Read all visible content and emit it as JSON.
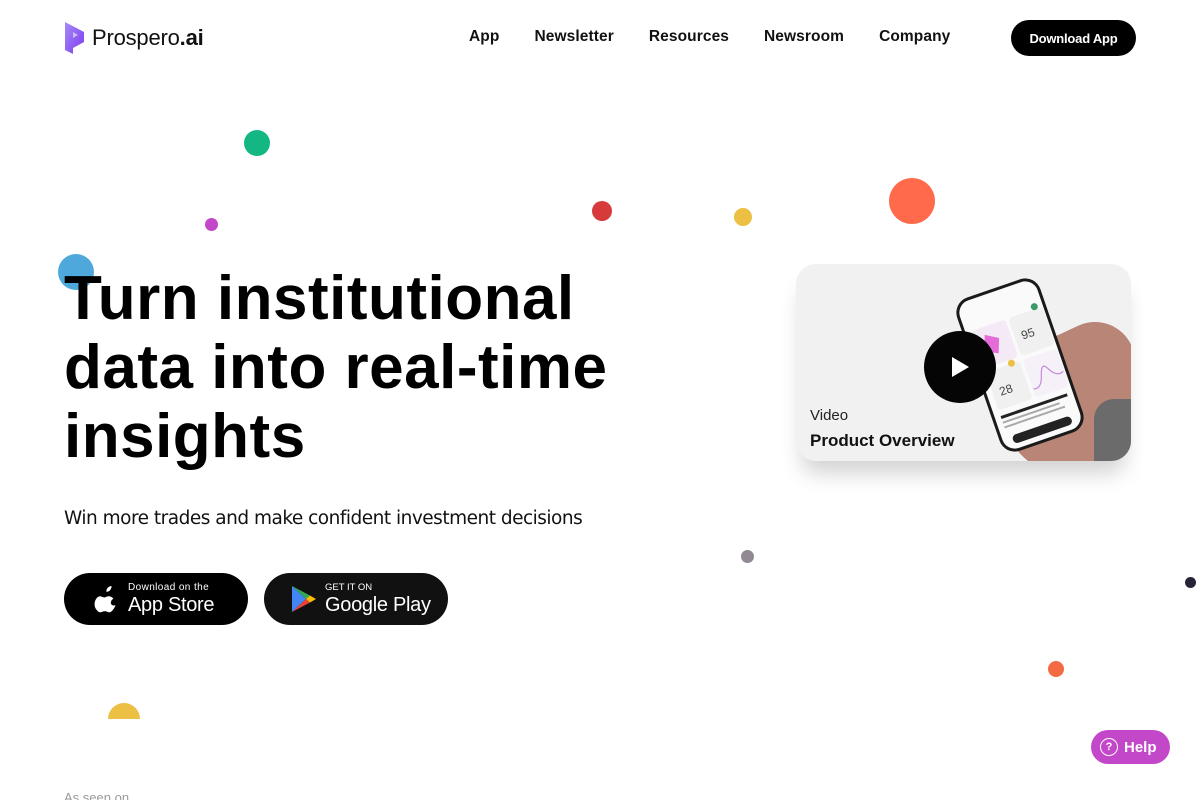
{
  "brand": {
    "name_regular": "Prospero",
    "name_bold": ".ai",
    "accent": "#8b5cf6"
  },
  "nav": {
    "links": [
      {
        "label": "App"
      },
      {
        "label": "Newsletter"
      },
      {
        "label": "Resources"
      },
      {
        "label": "Newsroom"
      },
      {
        "label": "Company"
      }
    ],
    "cta_label": "Download App"
  },
  "hero": {
    "headline_lines": [
      "Turn institutional",
      "data into real-time",
      "insights"
    ],
    "subheadline": "Win more trades and make confident investment decisions",
    "app_store": {
      "small": "Download on the",
      "big": "App Store",
      "icon": "apple-icon"
    },
    "google_play": {
      "small": "GET IT ON",
      "big": "Google Play",
      "icon": "google-play-icon"
    }
  },
  "video_card": {
    "label": "Video",
    "title": "Product Overview",
    "icon": "play-icon",
    "phone_values": [
      "95",
      "28"
    ]
  },
  "decorative_dots": [
    {
      "color": "#13b784"
    },
    {
      "color": "#c347c9"
    },
    {
      "color": "#d63a3a"
    },
    {
      "color": "#ecc043"
    },
    {
      "color": "#ff6b4a"
    },
    {
      "color": "#4ea8dc"
    },
    {
      "color": "#918a94"
    },
    {
      "color": "#262538"
    },
    {
      "color": "#f36a45"
    },
    {
      "color": "#ecc043"
    }
  ],
  "footer_teaser": "As seen on",
  "help": {
    "label": "Help",
    "icon": "question-icon",
    "color": "#c347c9"
  }
}
